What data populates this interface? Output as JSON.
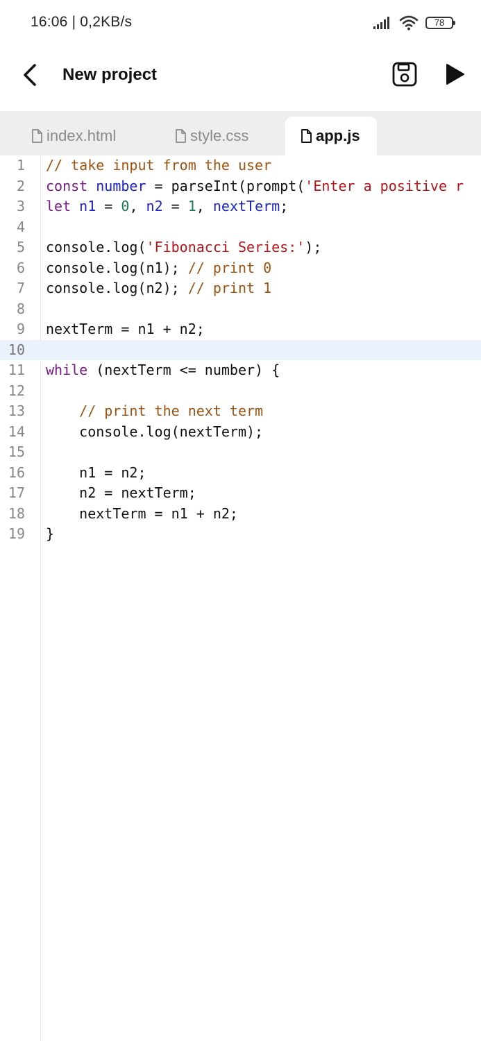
{
  "status_bar": {
    "time": "16:06 | 0,2KB/s",
    "battery": "78"
  },
  "header": {
    "title": "New project"
  },
  "tabs": [
    {
      "label": "index.html",
      "active": false
    },
    {
      "label": "style.css",
      "active": false
    },
    {
      "label": "app.js",
      "active": true
    }
  ],
  "editor": {
    "active_line": 10,
    "lines": [
      {
        "n": "1",
        "tokens": [
          {
            "t": "// take input from the user",
            "c": "com"
          }
        ]
      },
      {
        "n": "2",
        "tokens": [
          {
            "t": "const",
            "c": "kw"
          },
          {
            "t": " ",
            "c": "plain"
          },
          {
            "t": "number",
            "c": "var"
          },
          {
            "t": " = parseInt(prompt(",
            "c": "plain"
          },
          {
            "t": "'Enter a positive r",
            "c": "str"
          }
        ]
      },
      {
        "n": "3",
        "tokens": [
          {
            "t": "let",
            "c": "kw"
          },
          {
            "t": " ",
            "c": "plain"
          },
          {
            "t": "n1",
            "c": "var"
          },
          {
            "t": " = ",
            "c": "plain"
          },
          {
            "t": "0",
            "c": "num"
          },
          {
            "t": ", ",
            "c": "plain"
          },
          {
            "t": "n2",
            "c": "var"
          },
          {
            "t": " = ",
            "c": "plain"
          },
          {
            "t": "1",
            "c": "num"
          },
          {
            "t": ", ",
            "c": "plain"
          },
          {
            "t": "nextTerm",
            "c": "var"
          },
          {
            "t": ";",
            "c": "plain"
          }
        ]
      },
      {
        "n": "4",
        "tokens": []
      },
      {
        "n": "5",
        "tokens": [
          {
            "t": "console.log(",
            "c": "plain"
          },
          {
            "t": "'Fibonacci Series:'",
            "c": "str"
          },
          {
            "t": ");",
            "c": "plain"
          }
        ]
      },
      {
        "n": "6",
        "tokens": [
          {
            "t": "console.log(n1); ",
            "c": "plain"
          },
          {
            "t": "// print 0",
            "c": "com"
          }
        ]
      },
      {
        "n": "7",
        "tokens": [
          {
            "t": "console.log(n2); ",
            "c": "plain"
          },
          {
            "t": "// print 1",
            "c": "com"
          }
        ]
      },
      {
        "n": "8",
        "tokens": []
      },
      {
        "n": "9",
        "tokens": [
          {
            "t": "nextTerm = n1 + n2;",
            "c": "plain"
          }
        ]
      },
      {
        "n": "10",
        "tokens": []
      },
      {
        "n": "11",
        "tokens": [
          {
            "t": "while",
            "c": "kw"
          },
          {
            "t": " (nextTerm <= number) {",
            "c": "plain"
          }
        ]
      },
      {
        "n": "12",
        "tokens": []
      },
      {
        "n": "13",
        "tokens": [
          {
            "t": "    ",
            "c": "plain"
          },
          {
            "t": "// print the next term",
            "c": "com"
          }
        ]
      },
      {
        "n": "14",
        "tokens": [
          {
            "t": "    console.log(nextTerm);",
            "c": "plain"
          }
        ]
      },
      {
        "n": "15",
        "tokens": []
      },
      {
        "n": "16",
        "tokens": [
          {
            "t": "    n1 = n2;",
            "c": "plain"
          }
        ]
      },
      {
        "n": "17",
        "tokens": [
          {
            "t": "    n2 = nextTerm;",
            "c": "plain"
          }
        ]
      },
      {
        "n": "18",
        "tokens": [
          {
            "t": "    nextTerm = n1 + n2;",
            "c": "plain"
          }
        ]
      },
      {
        "n": "19",
        "tokens": [
          {
            "t": "}",
            "c": "plain"
          }
        ]
      }
    ]
  }
}
